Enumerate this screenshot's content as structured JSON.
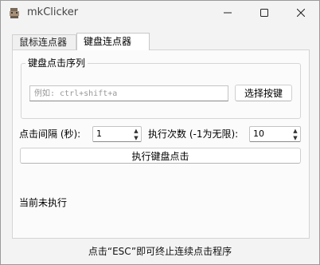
{
  "window": {
    "title": "mkClicker",
    "icons": {
      "app": "app-logo-icon",
      "minimize": "minimize-icon",
      "maximize": "maximize-icon",
      "close": "close-icon"
    }
  },
  "tabs": [
    {
      "label": "鼠标连点器",
      "selected": false
    },
    {
      "label": "键盘连点器",
      "selected": true
    }
  ],
  "keyboard": {
    "group_title": "键盘点击序列",
    "sequence_input": {
      "value": "",
      "placeholder": "例如: ctrl+shift+a"
    },
    "select_key_label": "选择按键",
    "interval_label": "点击间隔 (秒):",
    "interval_value": "1",
    "count_label": "执行次数 (-1为无限):",
    "count_value": "10",
    "run_label": "执行键盘点击",
    "status": "当前未执行"
  },
  "footer": "点击“ESC”即可终止连续点击程序"
}
